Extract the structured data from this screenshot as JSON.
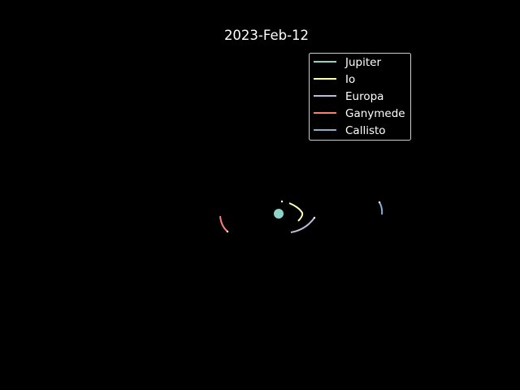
{
  "title": "2023-Feb-12",
  "legend": {
    "entries": [
      {
        "name": "Jupiter",
        "color": "#8dd3c7"
      },
      {
        "name": "Io",
        "color": "#ffffb3"
      },
      {
        "name": "Europa",
        "color": "#bebada"
      },
      {
        "name": "Ganymede",
        "color": "#fb8072"
      },
      {
        "name": "Callisto",
        "color": "#80b1d3"
      }
    ]
  },
  "background_color": "#000000"
}
